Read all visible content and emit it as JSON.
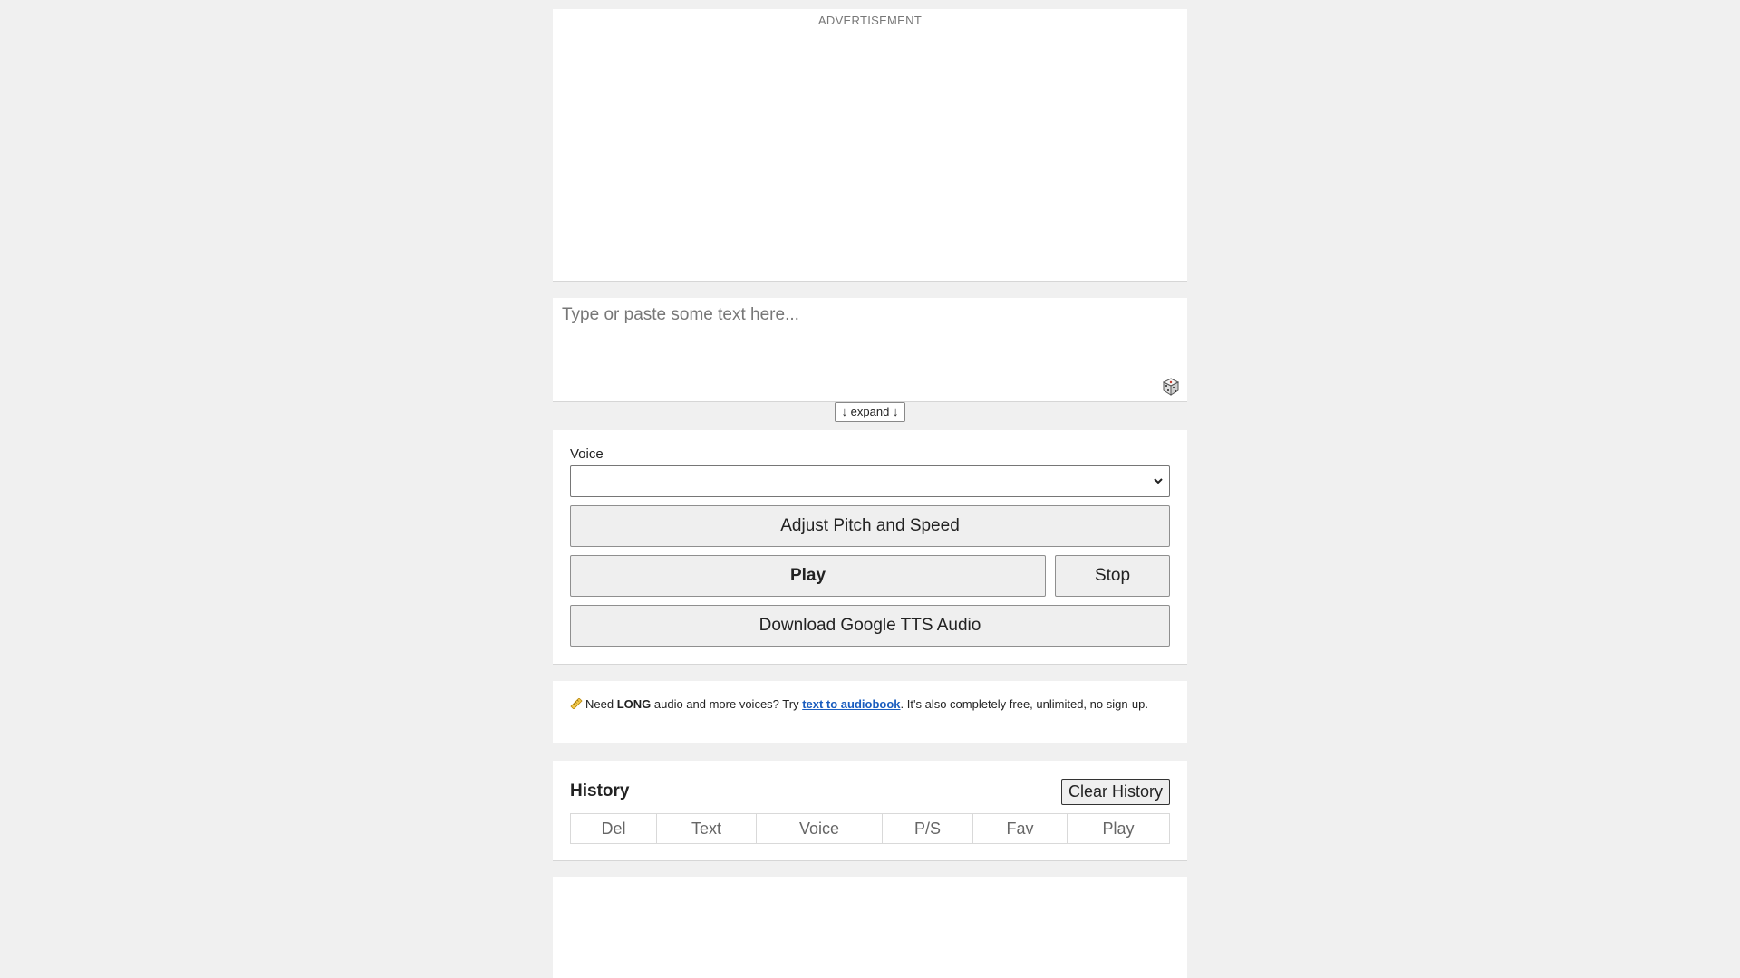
{
  "ad": {
    "label": "ADVERTISEMENT"
  },
  "editor": {
    "placeholder": "Type or paste some text here...",
    "value": "",
    "random_icon": "dice-icon",
    "expand_label": "↓ expand ↓"
  },
  "controls": {
    "voice_label": "Voice",
    "voice_selected": "",
    "adjust_label": "Adjust Pitch and Speed",
    "play_label": "Play",
    "stop_label": "Stop",
    "download_label": "Download Google TTS Audio"
  },
  "tip": {
    "icon": "ruler-icon",
    "text_before": "Need ",
    "text_strong": "LONG",
    "text_middle": " audio and more voices? Try ",
    "link_text": "text to audiobook",
    "text_after": ". It's also completely free, unlimited, no sign-up."
  },
  "history": {
    "title": "History",
    "clear_label": "Clear History",
    "columns": [
      "Del",
      "Text",
      "Voice",
      "P/S",
      "Fav",
      "Play"
    ]
  }
}
